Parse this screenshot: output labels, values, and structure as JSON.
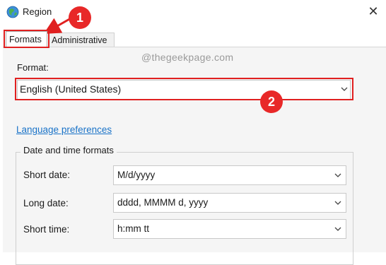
{
  "window": {
    "title": "Region",
    "close_symbol": "✕"
  },
  "tabs": [
    {
      "label": "Formats",
      "selected": true
    },
    {
      "label": "Administrative",
      "selected": false
    }
  ],
  "watermark": "@thegeekpage.com",
  "format": {
    "label": "Format:",
    "value": "English (United States)"
  },
  "links": {
    "language_preferences": "Language preferences"
  },
  "date_time": {
    "group_title": "Date and time formats",
    "rows": [
      {
        "label": "Short date:",
        "value": "M/d/yyyy"
      },
      {
        "label": "Long date:",
        "value": "dddd, MMMM d, yyyy"
      },
      {
        "label": "Short time:",
        "value": "h:mm tt"
      }
    ]
  },
  "annotations": {
    "badge_1": "1",
    "badge_2": "2",
    "highlight_color": "#e02020"
  },
  "icons": {
    "app": "globe-icon",
    "close": "close-icon",
    "dropdown": "chevron-down-icon"
  }
}
